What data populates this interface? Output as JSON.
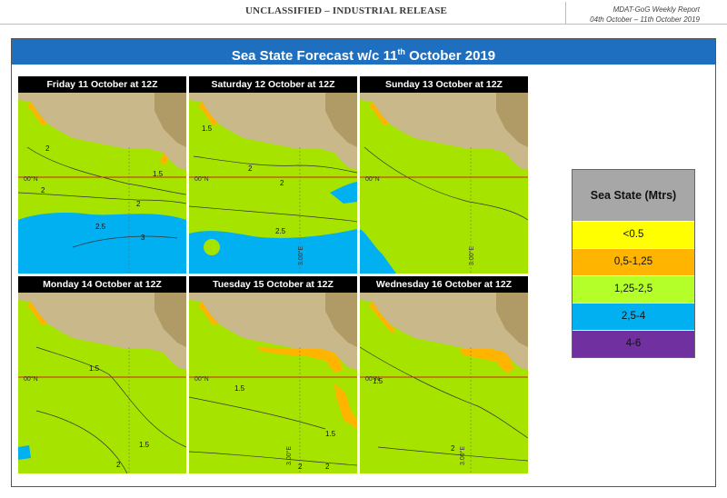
{
  "header": {
    "classification": "UNCLASSIFIED – INDUSTRIAL RELEASE",
    "report_title": "MDAT-GoG Weekly Report",
    "report_dates": "04th October – 11th October 2019"
  },
  "banner": {
    "title_prefix": "Sea State Forecast w/c 11",
    "title_sup": "th",
    "title_suffix": " October 2019"
  },
  "panels": [
    {
      "title": "Friday 11 October at  12Z",
      "labels": [
        "2",
        "2",
        "2.5",
        "3",
        "2",
        "1.5",
        "00°N"
      ]
    },
    {
      "title": "Saturday 12 October at  12Z",
      "labels": [
        "1.5",
        "2",
        "2",
        "2.5",
        "3.00°E",
        "00°N"
      ]
    },
    {
      "title": "Sunday 13 October at  12Z",
      "labels": [
        "00°N",
        "3.00°E"
      ]
    },
    {
      "title": "Monday  14 October at  12Z",
      "labels": [
        "1.5",
        "2",
        "1.5",
        "00°N"
      ]
    },
    {
      "title": "Tuesday 15 October at  12Z",
      "labels": [
        "1.5",
        "1.5",
        "2",
        "2",
        "3.00°E",
        "00°N"
      ]
    },
    {
      "title": "Wednesday 16 October at  12Z",
      "labels": [
        "1.5",
        "2",
        "3.00°E",
        "00°N"
      ]
    }
  ],
  "legend": {
    "title": "Sea State (Mtrs)",
    "rows": [
      {
        "label": "<0.5",
        "color": "#ffff00"
      },
      {
        "label": "0,5-1,25",
        "color": "#ffb400"
      },
      {
        "label": "1,25-2,5",
        "color": "#b4ff2a"
      },
      {
        "label": "2,5-4",
        "color": "#00b0f0"
      },
      {
        "label": "4-6",
        "color": "#7030a0"
      }
    ]
  },
  "colors": {
    "banner": "#1e6fc0",
    "sea_calm": "#a6e400",
    "sea_moderate": "#ffb400",
    "sea_rough": "#00b0f0",
    "land": "#c9b98a",
    "equator": "#cc2222"
  }
}
